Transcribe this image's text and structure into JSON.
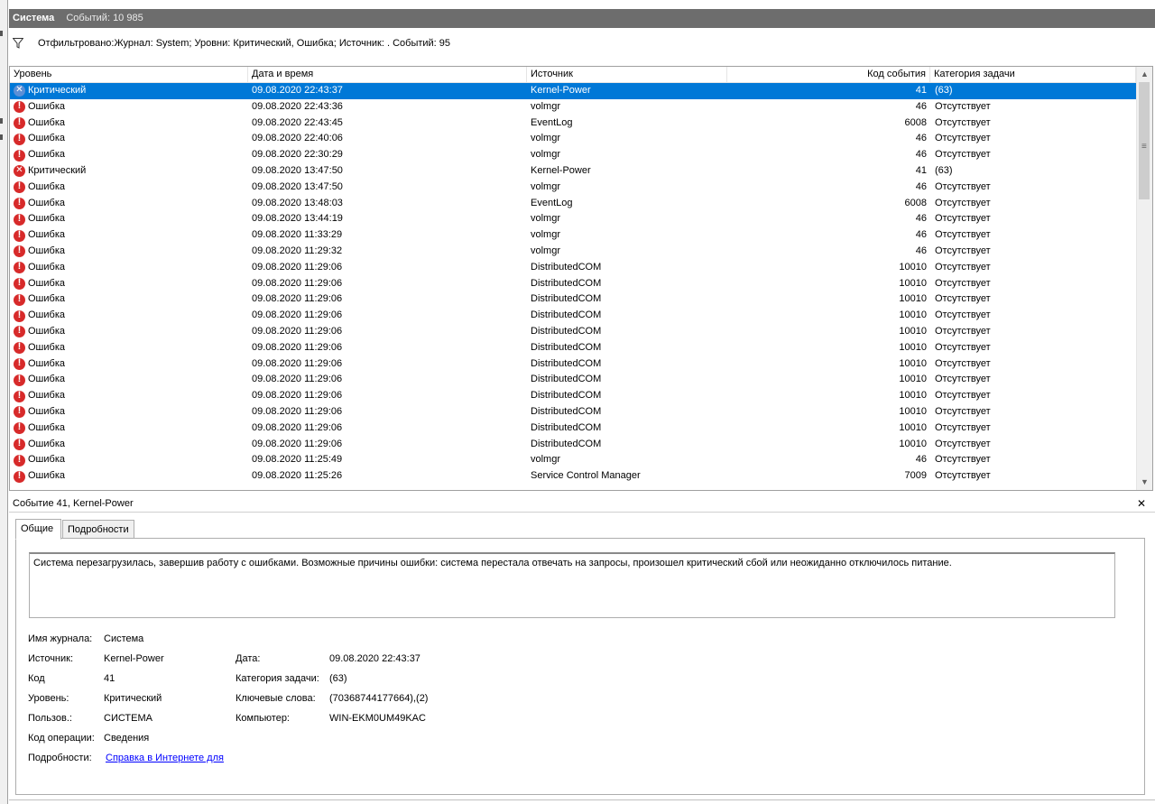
{
  "title_bar": {
    "name": "Система",
    "count": "Событий: 10 985"
  },
  "filter": {
    "text": "Отфильтровано:Журнал: System; Уровни: Критический, Ошибка; Источник: . Событий: 95"
  },
  "columns": {
    "level": "Уровень",
    "date": "Дата и время",
    "source": "Источник",
    "code": "Код события",
    "category": "Категория задачи"
  },
  "rows": [
    {
      "type": "crit",
      "level": "Критический",
      "date": "09.08.2020 22:43:37",
      "source": "Kernel-Power",
      "code": "41",
      "category": "(63)",
      "selected": true
    },
    {
      "type": "err",
      "level": "Ошибка",
      "date": "09.08.2020 22:43:36",
      "source": "volmgr",
      "code": "46",
      "category": "Отсутствует"
    },
    {
      "type": "err",
      "level": "Ошибка",
      "date": "09.08.2020 22:43:45",
      "source": "EventLog",
      "code": "6008",
      "category": "Отсутствует"
    },
    {
      "type": "err",
      "level": "Ошибка",
      "date": "09.08.2020 22:40:06",
      "source": "volmgr",
      "code": "46",
      "category": "Отсутствует"
    },
    {
      "type": "err",
      "level": "Ошибка",
      "date": "09.08.2020 22:30:29",
      "source": "volmgr",
      "code": "46",
      "category": "Отсутствует"
    },
    {
      "type": "crit",
      "level": "Критический",
      "date": "09.08.2020 13:47:50",
      "source": "Kernel-Power",
      "code": "41",
      "category": "(63)"
    },
    {
      "type": "err",
      "level": "Ошибка",
      "date": "09.08.2020 13:47:50",
      "source": "volmgr",
      "code": "46",
      "category": "Отсутствует"
    },
    {
      "type": "err",
      "level": "Ошибка",
      "date": "09.08.2020 13:48:03",
      "source": "EventLog",
      "code": "6008",
      "category": "Отсутствует"
    },
    {
      "type": "err",
      "level": "Ошибка",
      "date": "09.08.2020 13:44:19",
      "source": "volmgr",
      "code": "46",
      "category": "Отсутствует"
    },
    {
      "type": "err",
      "level": "Ошибка",
      "date": "09.08.2020 11:33:29",
      "source": "volmgr",
      "code": "46",
      "category": "Отсутствует"
    },
    {
      "type": "err",
      "level": "Ошибка",
      "date": "09.08.2020 11:29:32",
      "source": "volmgr",
      "code": "46",
      "category": "Отсутствует"
    },
    {
      "type": "err",
      "level": "Ошибка",
      "date": "09.08.2020 11:29:06",
      "source": "DistributedCOM",
      "code": "10010",
      "category": "Отсутствует"
    },
    {
      "type": "err",
      "level": "Ошибка",
      "date": "09.08.2020 11:29:06",
      "source": "DistributedCOM",
      "code": "10010",
      "category": "Отсутствует"
    },
    {
      "type": "err",
      "level": "Ошибка",
      "date": "09.08.2020 11:29:06",
      "source": "DistributedCOM",
      "code": "10010",
      "category": "Отсутствует"
    },
    {
      "type": "err",
      "level": "Ошибка",
      "date": "09.08.2020 11:29:06",
      "source": "DistributedCOM",
      "code": "10010",
      "category": "Отсутствует"
    },
    {
      "type": "err",
      "level": "Ошибка",
      "date": "09.08.2020 11:29:06",
      "source": "DistributedCOM",
      "code": "10010",
      "category": "Отсутствует"
    },
    {
      "type": "err",
      "level": "Ошибка",
      "date": "09.08.2020 11:29:06",
      "source": "DistributedCOM",
      "code": "10010",
      "category": "Отсутствует"
    },
    {
      "type": "err",
      "level": "Ошибка",
      "date": "09.08.2020 11:29:06",
      "source": "DistributedCOM",
      "code": "10010",
      "category": "Отсутствует"
    },
    {
      "type": "err",
      "level": "Ошибка",
      "date": "09.08.2020 11:29:06",
      "source": "DistributedCOM",
      "code": "10010",
      "category": "Отсутствует"
    },
    {
      "type": "err",
      "level": "Ошибка",
      "date": "09.08.2020 11:29:06",
      "source": "DistributedCOM",
      "code": "10010",
      "category": "Отсутствует"
    },
    {
      "type": "err",
      "level": "Ошибка",
      "date": "09.08.2020 11:29:06",
      "source": "DistributedCOM",
      "code": "10010",
      "category": "Отсутствует"
    },
    {
      "type": "err",
      "level": "Ошибка",
      "date": "09.08.2020 11:29:06",
      "source": "DistributedCOM",
      "code": "10010",
      "category": "Отсутствует"
    },
    {
      "type": "err",
      "level": "Ошибка",
      "date": "09.08.2020 11:29:06",
      "source": "DistributedCOM",
      "code": "10010",
      "category": "Отсутствует"
    },
    {
      "type": "err",
      "level": "Ошибка",
      "date": "09.08.2020 11:25:49",
      "source": "volmgr",
      "code": "46",
      "category": "Отсутствует"
    },
    {
      "type": "err",
      "level": "Ошибка",
      "date": "09.08.2020 11:25:26",
      "source": "Service Control Manager",
      "code": "7009",
      "category": "Отсутствует"
    }
  ],
  "detail": {
    "title": "Событие 41, Kernel-Power",
    "close_icon": "close-icon",
    "tabs": [
      "Общие",
      "Подробности"
    ],
    "description": "Система перезагрузилась, завершив работу с ошибками. Возможные причины ошибки: система перестала отвечать на запросы, произошел критический сбой или неожиданно отключилось питание.",
    "labels": {
      "log": "Имя журнала:",
      "source": "Источник:",
      "code": "Код",
      "level": "Уровень:",
      "user": "Пользов.:",
      "opcode": "Код операции:",
      "more": "Подробности:",
      "date": "Дата:",
      "category": "Категория задачи:",
      "keywords": "Ключевые слова:",
      "computer": "Компьютер:"
    },
    "values": {
      "log": "Система",
      "source": "Kernel-Power",
      "code": "41",
      "level": "Критический",
      "user": "СИСТЕМА",
      "opcode": "Сведения",
      "more_link": "Справка в Интернете для ",
      "date": "09.08.2020 22:43:37",
      "category": "(63)",
      "keywords": "(70368744177664),(2)",
      "computer": "WIN-EKM0UM49KAC"
    }
  },
  "colors": {
    "selection": "#0078d7",
    "title_bar": "#6d6d6d",
    "error_icon": "#d72a2a",
    "link": "#0000ff"
  }
}
